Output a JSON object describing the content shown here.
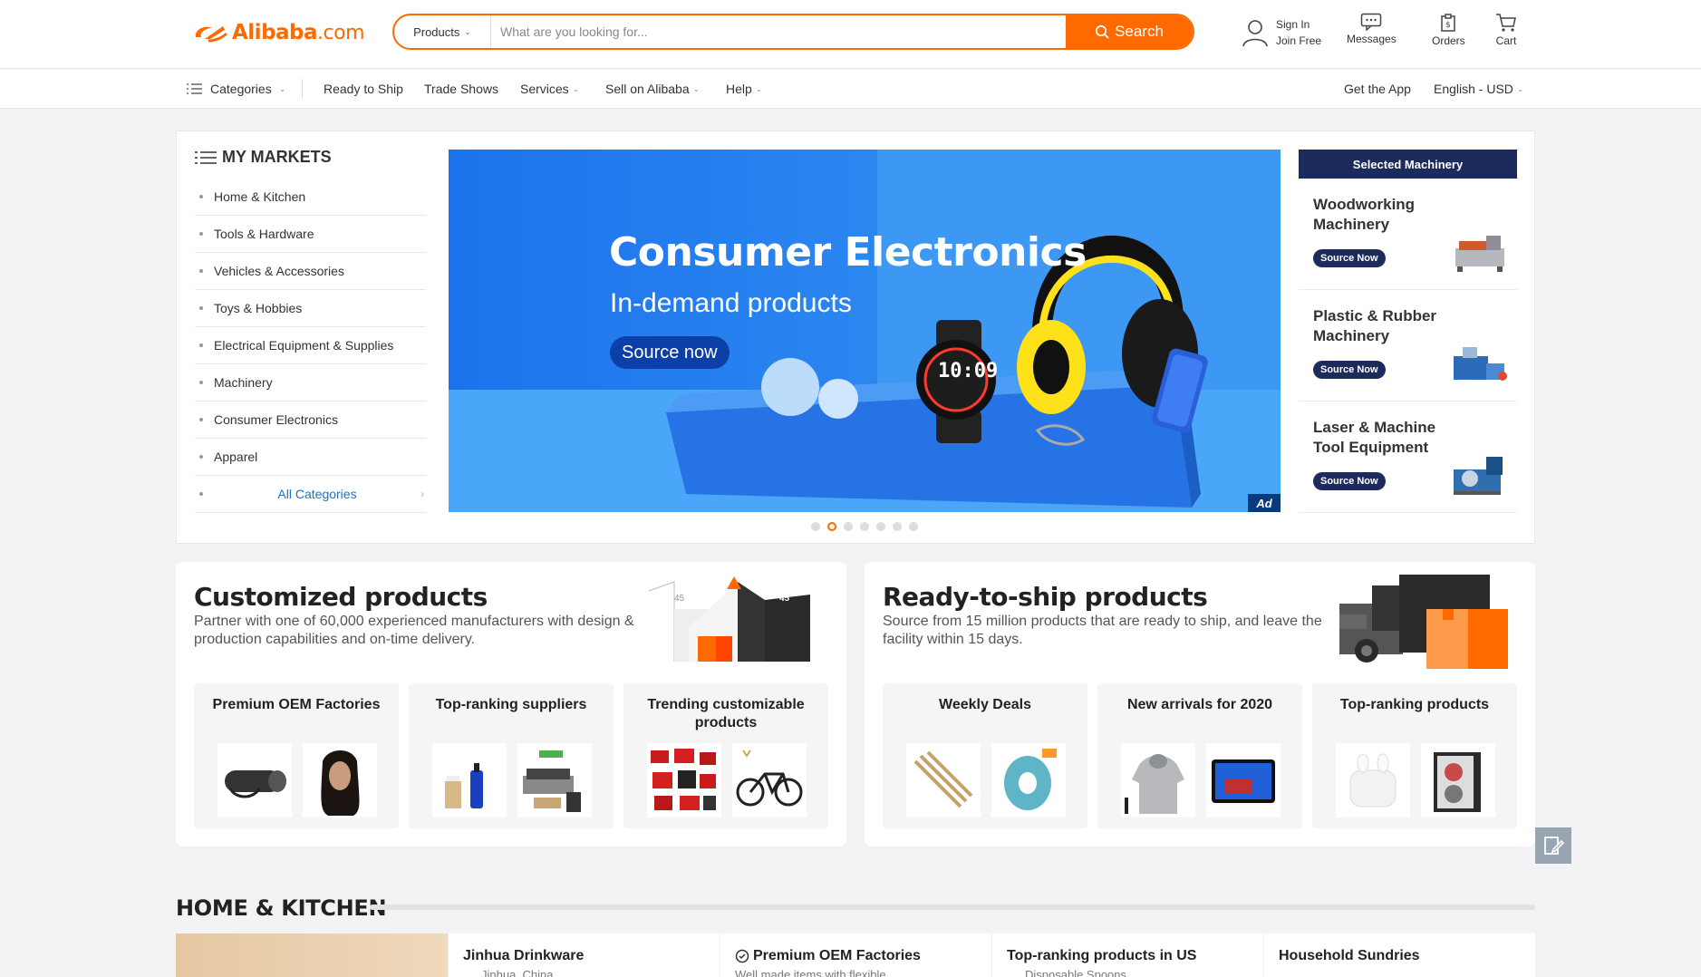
{
  "header": {
    "logo_main": "Alibaba",
    "logo_suffix": ".com",
    "search": {
      "category": "Products",
      "placeholder": "What are you looking for...",
      "button_label": "Search"
    },
    "signin": {
      "line1": "Sign In",
      "line2": "Join Free"
    },
    "messages_label": "Messages",
    "orders_label": "Orders",
    "cart_label": "Cart"
  },
  "nav": {
    "categories": "Categories",
    "ready_to_ship": "Ready to Ship",
    "trade_shows": "Trade Shows",
    "services": "Services",
    "sell": "Sell on Alibaba",
    "help": "Help",
    "get_app": "Get the App",
    "language": "English - USD"
  },
  "markets": {
    "title": "MY MARKETS",
    "items": [
      "Home & Kitchen",
      "Tools & Hardware",
      "Vehicles & Accessories",
      "Toys & Hobbies",
      "Electrical Equipment & Supplies",
      "Machinery",
      "Consumer Electronics",
      "Apparel"
    ],
    "all_label": "All Categories"
  },
  "banner": {
    "title": "Consumer Electronics",
    "subtitle": "In-demand products",
    "button": "Source now",
    "ad_label": "Ad",
    "watch_time": "10:09",
    "active_slide": 2,
    "slide_count": 7
  },
  "machinery": {
    "header": "Selected Machinery",
    "items": [
      {
        "name": "Woodworking Machinery",
        "button": "Source Now"
      },
      {
        "name": "Plastic & Rubber Machinery",
        "button": "Source Now"
      },
      {
        "name": "Laser & Machine Tool Equipment",
        "button": "Source Now"
      }
    ]
  },
  "customized": {
    "title": "Customized products",
    "desc": "Partner with one of 60,000 experienced manufacturers with design & production capabilities and on-time delivery.",
    "angle_left": "45",
    "angle_right": "45",
    "cards": [
      "Premium OEM Factories",
      "Top-ranking suppliers",
      "Trending customizable products"
    ]
  },
  "ready": {
    "title": "Ready-to-ship products",
    "desc": "Source from 15 million products that are ready to ship, and leave the facility within 15 days.",
    "cards": [
      "Weekly Deals",
      "New arrivals for 2020",
      "Top-ranking products"
    ]
  },
  "home_kitchen": {
    "title": "HOME & KITCHEN",
    "cells": [
      {
        "title": "Jinhua Drinkware",
        "sub": "Jinhua, China"
      },
      {
        "title": "Premium OEM Factories",
        "sub": "Well made items with flexible"
      },
      {
        "title": "Top-ranking products in US",
        "sub": "Disposable Spoons"
      },
      {
        "title": "Household Sundries",
        "sub": ""
      }
    ]
  },
  "colors": {
    "accent": "#ff6a00",
    "navy": "#1d2a5c",
    "link": "#1a73c8"
  }
}
